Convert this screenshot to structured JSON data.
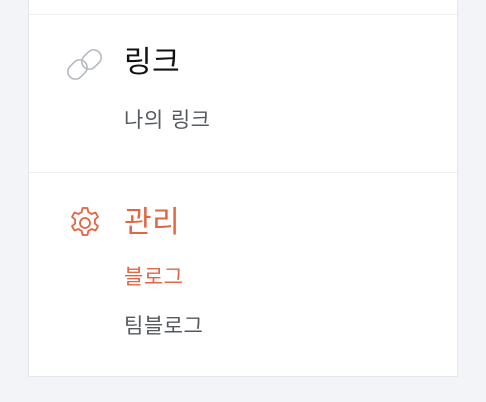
{
  "links_section": {
    "title": "링크",
    "icon": "link-icon",
    "items": [
      {
        "label": "나의 링크"
      }
    ]
  },
  "manage_section": {
    "title": "관리",
    "icon": "gear-icon",
    "items": [
      {
        "label": "블로그",
        "active": true
      },
      {
        "label": "팀블로그",
        "active": false
      }
    ]
  },
  "colors": {
    "accent": "#e06646",
    "icon_gray": "#b5b9be",
    "text_dark": "#111111",
    "text_muted": "#555a60",
    "background": "#f2f4f7"
  }
}
